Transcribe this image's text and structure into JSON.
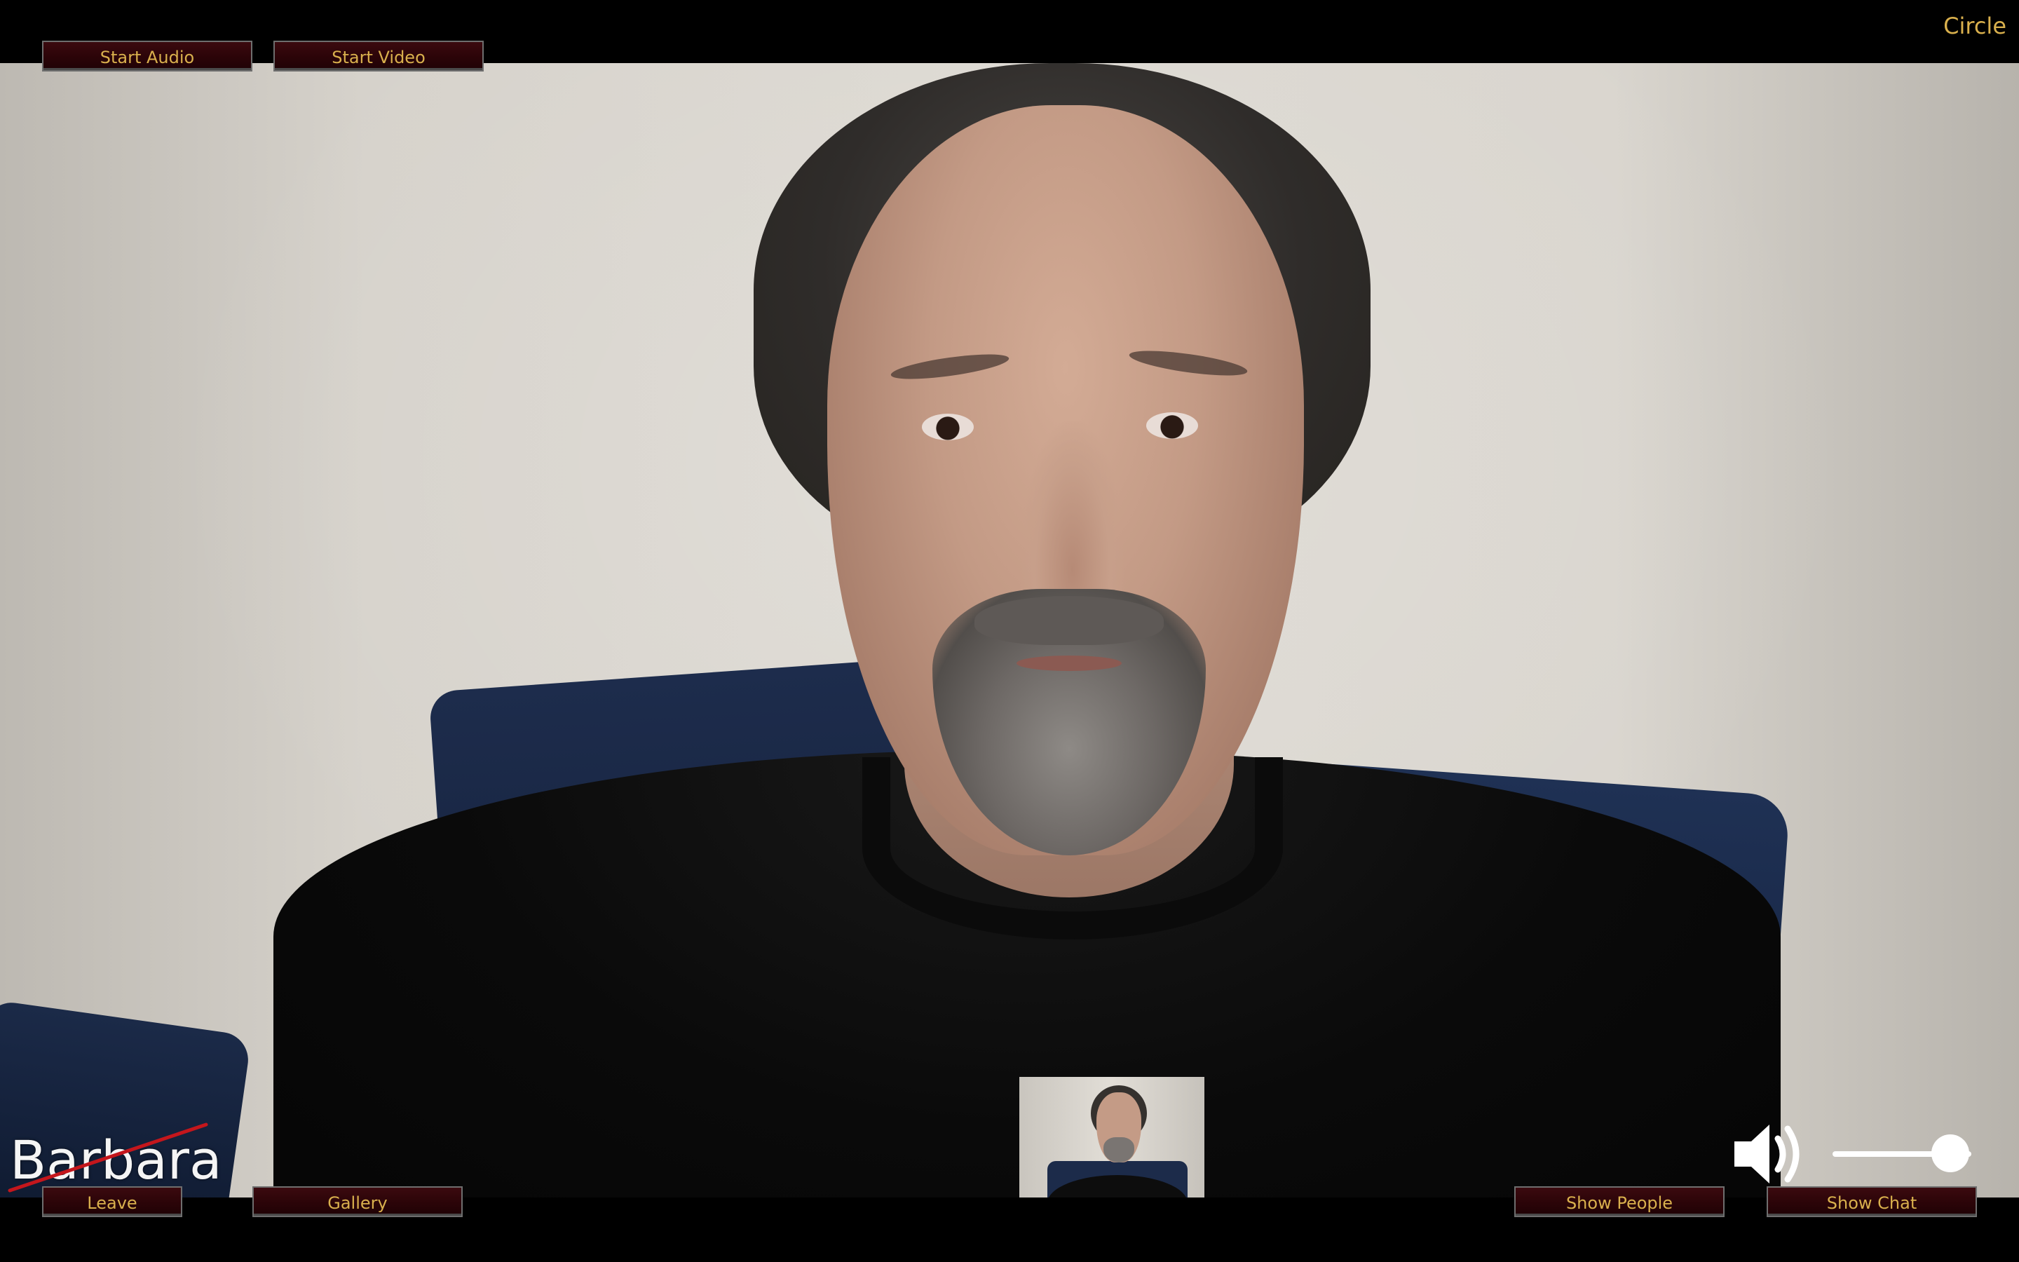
{
  "app": {
    "title": "Circle"
  },
  "toolbar_top": {
    "start_audio_label": "Start Audio",
    "start_video_label": "Start Video"
  },
  "toolbar_bottom": {
    "leave_label": "Leave",
    "gallery_label": "Gallery",
    "show_people_label": "Show People",
    "show_chat_label": "Show Chat"
  },
  "participant": {
    "name": "Barbara",
    "audio_muted": true,
    "muted_indicator_icon": "muted-slash-icon"
  },
  "self_view": {
    "visible": true
  },
  "volume": {
    "icon": "speaker-icon",
    "level": 0.85
  },
  "colors": {
    "accent_text": "#d9b04d",
    "button_fill": "#2b0408",
    "button_border": "#6e6e6e",
    "muted_slash": "#c4161c",
    "background": "#000000"
  }
}
